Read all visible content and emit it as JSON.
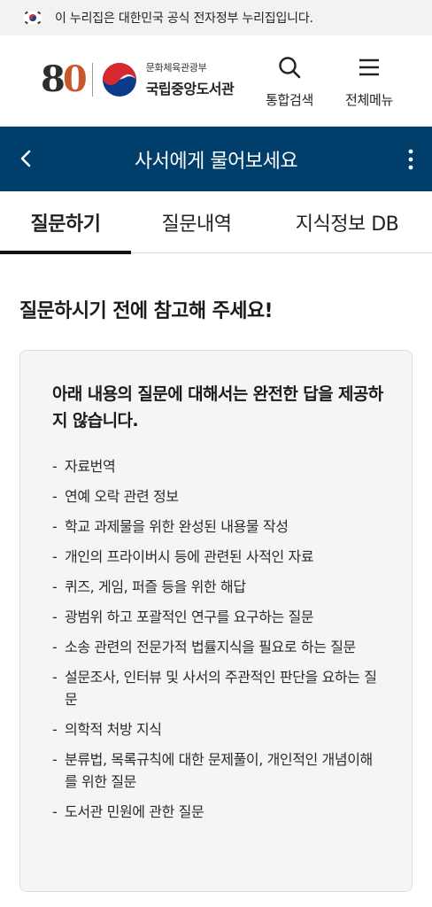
{
  "gov_banner": {
    "text": "이 누리집은 대한민국 공식 전자정부 누리집입니다."
  },
  "header": {
    "logo_number": [
      "8",
      "0"
    ],
    "ministry": "문화체육관광부",
    "library": "국립중앙도서관",
    "search_label": "통합검색",
    "menu_label": "전체메뉴"
  },
  "titlebar": {
    "title": "사서에게 물어보세요"
  },
  "tabs": [
    {
      "label": "질문하기",
      "active": true
    },
    {
      "label": "질문내역",
      "active": false
    },
    {
      "label": "지식정보 DB",
      "active": false
    }
  ],
  "main": {
    "heading": "질문하시기 전에 참고해 주세요!",
    "notice_title": "아래 내용의 질문에 대해서는 완전한 답을 제공하지 않습니다.",
    "items": [
      "자료번역",
      "연예 오락 관련 정보",
      "학교 과제물을 위한 완성된 내용물 작성",
      "개인의 프라이버시 등에 관련된 사적인 자료",
      "퀴즈, 게임, 퍼즐 등을 위한 해답",
      "광범위 하고 포괄적인 연구를 요구하는 질문",
      "소송 관련의 전문가적 법률지식을 필요로 하는 질문",
      "설문조사, 인터뷰 및 사서의 주관적인 판단을 요하는 질문",
      "의학적 처방 지식",
      "분류법, 목록규칙에 대한 문제풀이, 개인적인 개념이해를 위한 질문",
      "도서관 민원에 관한 질문"
    ]
  },
  "colors": {
    "titlebar_bg": "#003e6b",
    "notice_bg": "#f5f5f5"
  },
  "icons": [
    "korea-flag-icon",
    "government-emblem-icon",
    "search-icon",
    "hamburger-menu-icon",
    "back-chevron-icon",
    "more-vertical-icon"
  ]
}
